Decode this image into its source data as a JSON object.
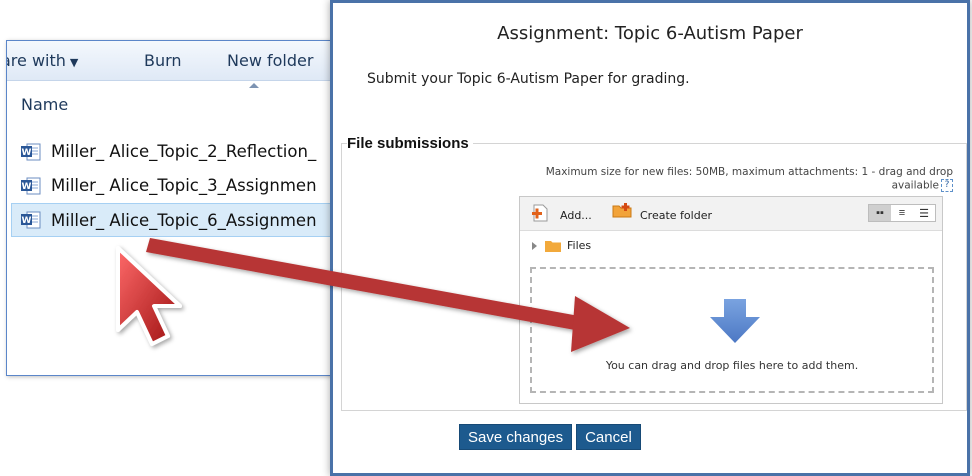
{
  "explorer": {
    "toolbar": {
      "share_with": "are with",
      "burn": "Burn",
      "new_folder": "New folder"
    },
    "column_name": "Name",
    "files": [
      {
        "name": "Miller_ Alice_Topic_2_Reflection_",
        "icon": "word-doc-icon"
      },
      {
        "name": "Miller_ Alice_Topic_3_Assignmen",
        "icon": "word-doc-icon"
      },
      {
        "name": "Miller_ Alice_Topic_6_Assignmen",
        "icon": "word-doc-icon",
        "selected": true
      }
    ]
  },
  "assignment": {
    "title": "Assignment: Topic 6-Autism Paper",
    "description": "Submit your Topic 6-Autism Paper for grading.",
    "section_legend": "File submissions",
    "max_size_text": "Maximum size for new files: 50MB, maximum attachments: 1 - drag and drop available",
    "filepicker": {
      "add_label": "Add...",
      "create_folder_label": "Create folder",
      "path_label": "Files",
      "drop_text": "You can drag and drop files here to add them.",
      "view_modes": [
        "icons-view-icon",
        "list-view-icon",
        "tree-view-icon"
      ]
    },
    "buttons": {
      "save": "Save changes",
      "cancel": "Cancel"
    }
  },
  "colors": {
    "panel_border": "#4a72a8",
    "button_bg": "#1d5a8e",
    "drag_arrow": "#b73434",
    "drop_arrow": "#5b8ad1",
    "selection": "#d9ebf9"
  }
}
